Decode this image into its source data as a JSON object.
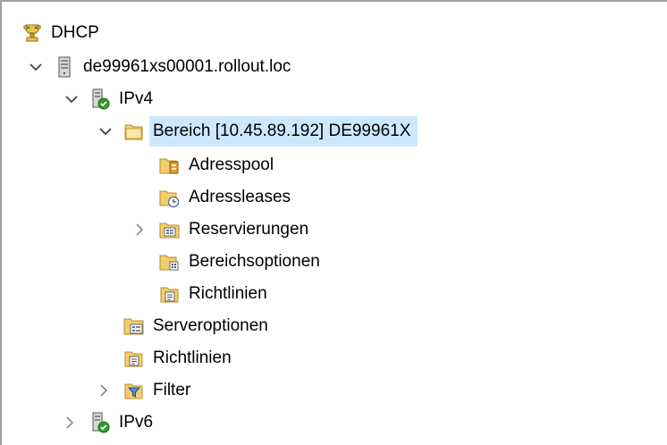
{
  "tree": {
    "root": {
      "label": "DHCP",
      "icon": "dhcp-icon"
    },
    "server": {
      "label": "de99961xs00001.rollout.loc",
      "icon": "server-icon",
      "expanded": true
    },
    "ipv4": {
      "label": "IPv4",
      "icon": "ipv4-icon",
      "expanded": true
    },
    "scope": {
      "label": "Bereich [10.45.89.192] DE99961X",
      "icon": "folder-open-icon",
      "expanded": true,
      "selected": true,
      "children": [
        {
          "label": "Adresspool",
          "icon": "address-pool-icon"
        },
        {
          "label": "Adressleases",
          "icon": "address-leases-icon"
        },
        {
          "label": "Reservierungen",
          "icon": "reservations-icon",
          "collapsed": true
        },
        {
          "label": "Bereichsoptionen",
          "icon": "scope-options-icon"
        },
        {
          "label": "Richtlinien",
          "icon": "policies-icon"
        }
      ]
    },
    "ipv4_children": [
      {
        "label": "Serveroptionen",
        "icon": "server-options-icon"
      },
      {
        "label": "Richtlinien",
        "icon": "policies-icon"
      },
      {
        "label": "Filter",
        "icon": "filter-icon",
        "collapsed": true
      }
    ],
    "ipv6": {
      "label": "IPv6",
      "icon": "ipv6-icon",
      "collapsed": true
    }
  },
  "colors": {
    "selection": "#cce8ff",
    "folder": "#f2cd6e",
    "status_green": "#2d9c2d"
  }
}
